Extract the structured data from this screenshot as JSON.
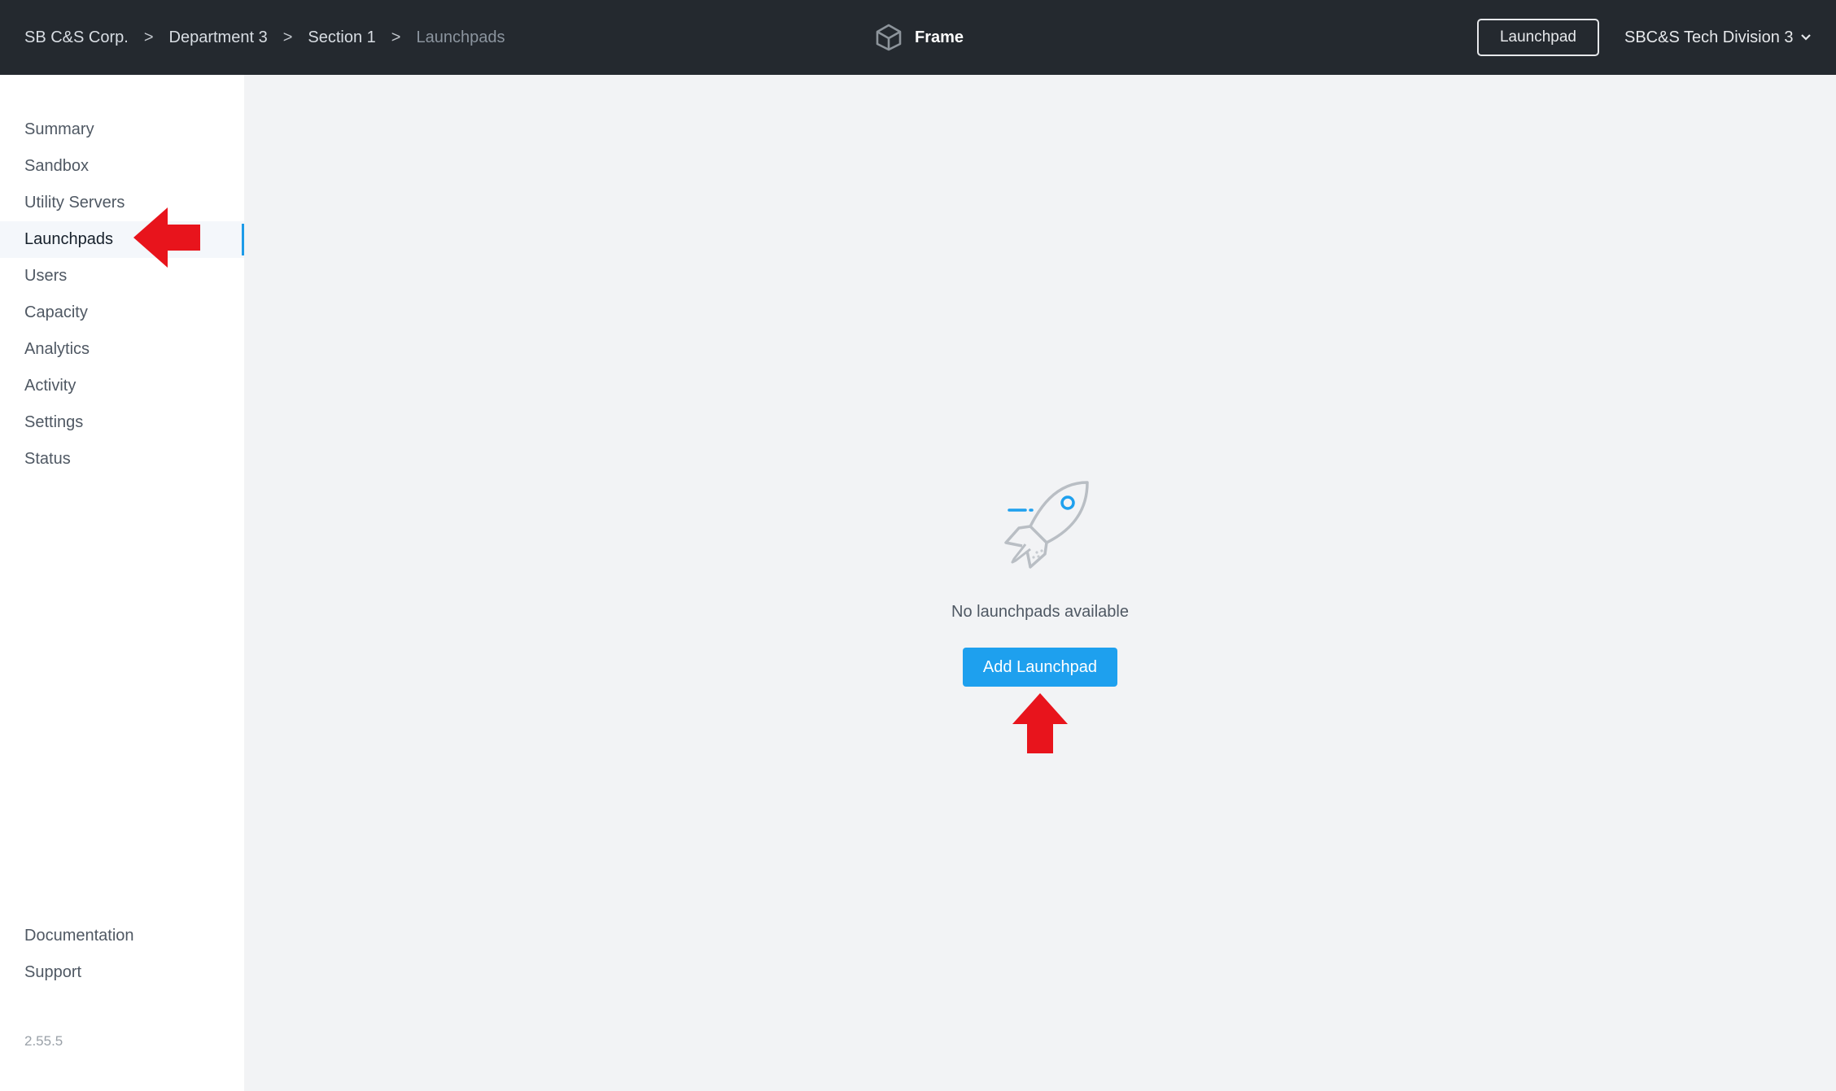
{
  "breadcrumb": {
    "items": [
      "SB C&S Corp.",
      "Department 3",
      "Section 1"
    ],
    "separator": ">",
    "current": "Launchpads"
  },
  "brand": {
    "name": "Frame",
    "icon": "cube-icon"
  },
  "header": {
    "launchpad_button": "Launchpad",
    "account": "SBC&S Tech Division 3",
    "account_icon": "chevron-down-icon"
  },
  "sidebar": {
    "items": [
      {
        "label": "Summary"
      },
      {
        "label": "Sandbox"
      },
      {
        "label": "Utility Servers"
      },
      {
        "label": "Launchpads",
        "active": true
      },
      {
        "label": "Users"
      },
      {
        "label": "Capacity"
      },
      {
        "label": "Analytics"
      },
      {
        "label": "Activity"
      },
      {
        "label": "Settings"
      },
      {
        "label": "Status"
      }
    ],
    "bottom_items": [
      {
        "label": "Documentation"
      },
      {
        "label": "Support"
      }
    ],
    "version": "2.55.5"
  },
  "empty_state": {
    "icon": "rocket-icon",
    "message": "No launchpads available",
    "button": "Add Launchpad"
  },
  "colors": {
    "topbar": "#24292f",
    "accent": "#1ea0ee",
    "annotation_arrow": "#e8141c"
  }
}
